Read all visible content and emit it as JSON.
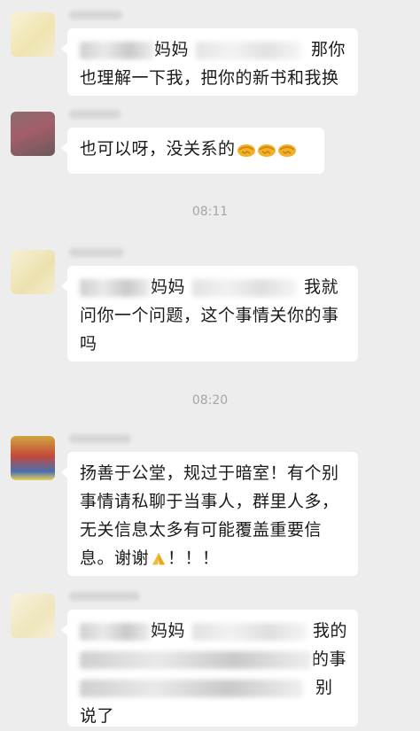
{
  "messages": [
    {
      "lines": [
        "妈妈",
        "那你",
        "也理解一下我，把你的新书和我换"
      ]
    },
    {
      "text": "也可以呀，没关系的"
    },
    {
      "lines": [
        "妈妈",
        "我就",
        "问你一个问题，这个事情关你的事",
        "吗"
      ]
    },
    {
      "lines": [
        "扬善于公堂，规过于暗室！有个别",
        "事情请私聊于当事人，群里人多，",
        "无关信息太多有可能覆盖重要信",
        "息。谢谢",
        "！！！"
      ]
    },
    {
      "lines": [
        "妈妈",
        "我的",
        "的事",
        "别",
        "说了"
      ]
    }
  ],
  "timestamps": [
    "08:11",
    "08:20"
  ],
  "icons": {
    "handshake": "handshake-emoji-icon",
    "pray": "folded-hands-emoji-icon"
  }
}
